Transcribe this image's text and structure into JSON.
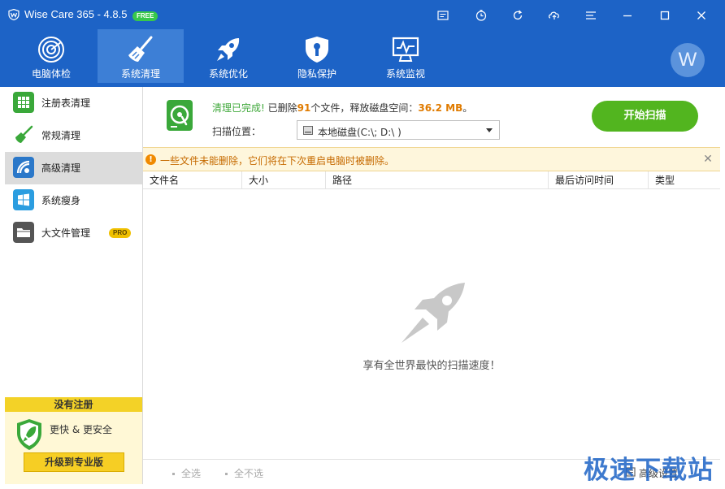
{
  "window": {
    "title": "Wise Care 365 - 4.8.5",
    "free_badge": "FREE"
  },
  "title_buttons": [
    {
      "name": "feedback-icon"
    },
    {
      "name": "timer-icon"
    },
    {
      "name": "refresh-icon"
    },
    {
      "name": "share-icon"
    },
    {
      "name": "menu-icon"
    },
    {
      "name": "minimize-icon"
    },
    {
      "name": "maximize-icon"
    },
    {
      "name": "close-icon"
    }
  ],
  "nav": [
    {
      "label": "电脑体检",
      "icon": "radar-icon"
    },
    {
      "label": "系统清理",
      "icon": "broom-icon",
      "active": true
    },
    {
      "label": "系统优化",
      "icon": "rocket-icon"
    },
    {
      "label": "隐私保护",
      "icon": "privacy-shield-icon"
    },
    {
      "label": "系统监视",
      "icon": "monitor-icon"
    }
  ],
  "avatar": {
    "letter": "W"
  },
  "sidebar": {
    "items": [
      {
        "label": "注册表清理",
        "icon": "registry-icon",
        "color": "#3aa83a"
      },
      {
        "label": "常规清理",
        "icon": "brush-icon",
        "color": "#3aa83a"
      },
      {
        "label": "高级清理",
        "icon": "advanced-clean-icon",
        "color": "#2b78c9",
        "active": true
      },
      {
        "label": "系统瘦身",
        "icon": "windows-icon",
        "color": "#2b9de0"
      },
      {
        "label": "大文件管理",
        "icon": "folder-icon",
        "color": "#555555",
        "badge": "PRO"
      }
    ],
    "register": {
      "header": "没有注册",
      "tagline": "更快 & 更安全",
      "upgrade_label": "升级到专业版"
    }
  },
  "status": {
    "done_text": "清理已完成!",
    "deleted_prefix": " 已删除",
    "deleted_count": "91",
    "deleted_suffix": "个文件，释放磁盘空间：",
    "freed_space": "36.2 MB",
    "freed_suffix": "。",
    "scan_location_label": "扫描位置：",
    "scan_location_value": "本地磁盘(C:\\; D:\\ )",
    "start_button": "开始扫描"
  },
  "warning": {
    "text": "一些文件未能删除，它们将在下次重启电脑时被删除。"
  },
  "columns": [
    "文件名",
    "大小",
    "路径",
    "最后访问时间",
    "类型"
  ],
  "empty_message": "享有全世界最快的扫描速度！",
  "footer": {
    "select_all": "全选",
    "select_none": "全不选",
    "advanced_settings": "高级设置"
  },
  "watermark": "极速下载站",
  "colors": {
    "brand": "#1d63c6",
    "start_button": "#52b51f",
    "warning_text": "#c66a00",
    "highlight_number": "#e07b00"
  }
}
